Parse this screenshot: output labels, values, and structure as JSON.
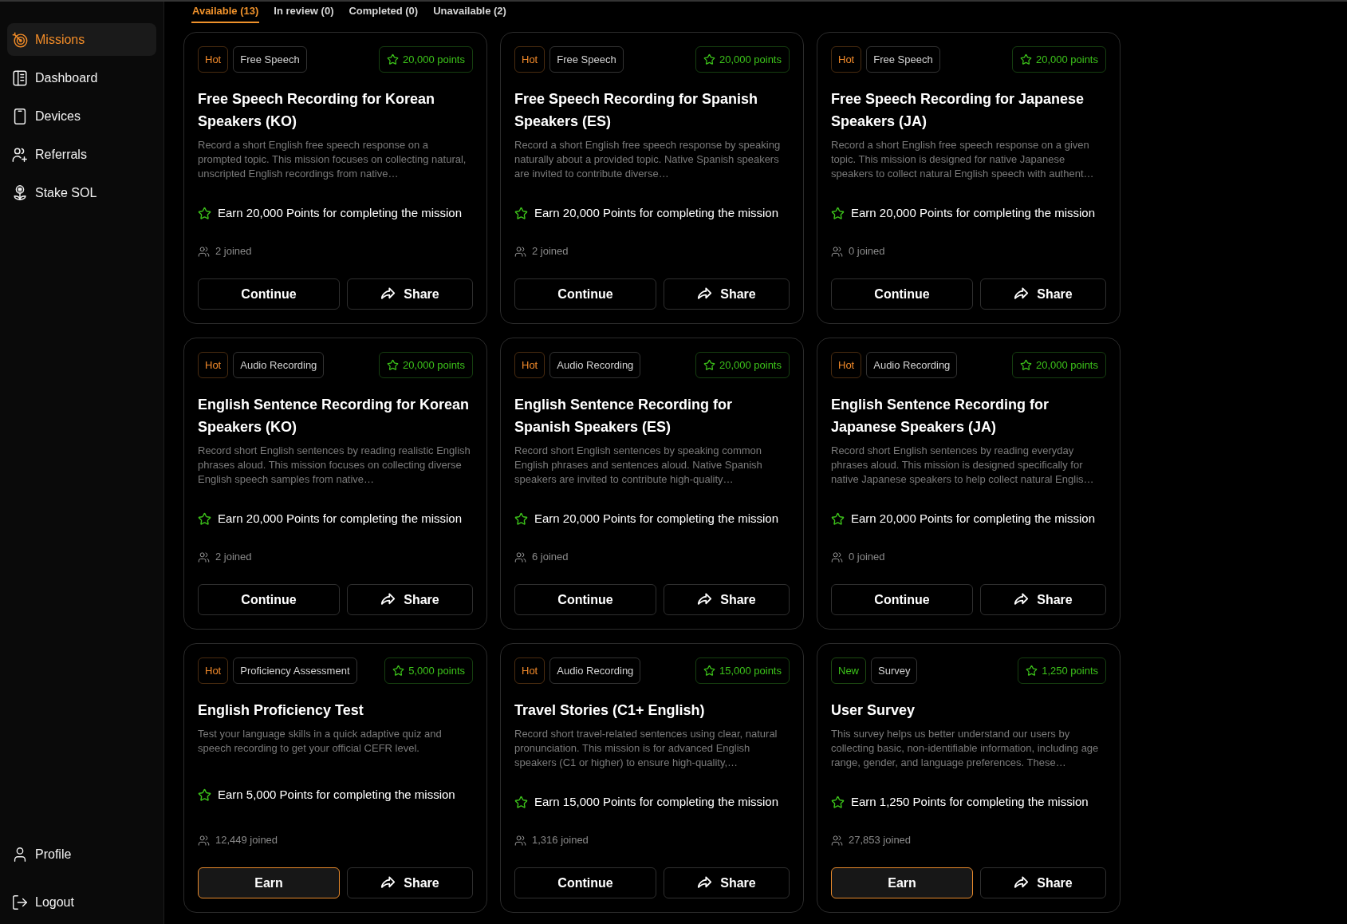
{
  "sidebar": {
    "items": [
      {
        "label": "Missions",
        "selected": true
      },
      {
        "label": "Dashboard",
        "selected": false
      },
      {
        "label": "Devices",
        "selected": false
      },
      {
        "label": "Referrals",
        "selected": false
      },
      {
        "label": "Stake SOL",
        "selected": false
      }
    ],
    "footer_items": [
      {
        "label": "Profile"
      },
      {
        "label": "Logout"
      }
    ]
  },
  "tabs": [
    {
      "label": "Available (13)",
      "selected": true
    },
    {
      "label": "In review (0)",
      "selected": false
    },
    {
      "label": "Completed (0)",
      "selected": false
    },
    {
      "label": "Unavailable (2)",
      "selected": false
    }
  ],
  "missions": [
    {
      "tags": [
        {
          "label": "Hot",
          "kind": "hot"
        },
        {
          "label": "Free Speech",
          "kind": "category"
        }
      ],
      "points": "20,000 points",
      "title": "Free Speech Recording for Korean Speakers (KO)",
      "description": "Record a short English free speech response on a prompted topic. This mission focuses on collecting natural, unscripted English recordings from native…",
      "reward": "Earn 20,000 Points for completing the mission",
      "joined": "2 joined",
      "action": {
        "label": "Continue",
        "highlighted": false
      },
      "share": "Share"
    },
    {
      "tags": [
        {
          "label": "Hot",
          "kind": "hot"
        },
        {
          "label": "Free Speech",
          "kind": "category"
        }
      ],
      "points": "20,000 points",
      "title": "Free Speech Recording for Spanish Speakers (ES)",
      "description": "Record a short English free speech response by speaking naturally about a provided topic. Native Spanish speakers are invited to contribute diverse…",
      "reward": "Earn 20,000 Points for completing the mission",
      "joined": "2 joined",
      "action": {
        "label": "Continue",
        "highlighted": false
      },
      "share": "Share"
    },
    {
      "tags": [
        {
          "label": "Hot",
          "kind": "hot"
        },
        {
          "label": "Free Speech",
          "kind": "category"
        }
      ],
      "points": "20,000 points",
      "title": "Free Speech Recording for Japanese Speakers (JA)",
      "description": "Record a short English free speech response on a given topic. This mission is designed for native Japanese speakers to collect natural English speech with authent…",
      "reward": "Earn 20,000 Points for completing the mission",
      "joined": "0 joined",
      "action": {
        "label": "Continue",
        "highlighted": false
      },
      "share": "Share"
    },
    {
      "tags": [
        {
          "label": "Hot",
          "kind": "hot"
        },
        {
          "label": "Audio Recording",
          "kind": "category"
        }
      ],
      "points": "20,000 points",
      "title": "English Sentence Recording for Korean Speakers (KO)",
      "description": "Record short English sentences by reading realistic English phrases aloud. This mission focuses on collecting diverse English speech samples from native…",
      "reward": "Earn 20,000 Points for completing the mission",
      "joined": "2 joined",
      "action": {
        "label": "Continue",
        "highlighted": false
      },
      "share": "Share"
    },
    {
      "tags": [
        {
          "label": "Hot",
          "kind": "hot"
        },
        {
          "label": "Audio Recording",
          "kind": "category"
        }
      ],
      "points": "20,000 points",
      "title": "English Sentence Recording for Spanish Speakers (ES)",
      "description": "Record short English sentences by speaking common English phrases and sentences aloud. Native Spanish speakers are invited to contribute high-quality…",
      "reward": "Earn 20,000 Points for completing the mission",
      "joined": "6 joined",
      "action": {
        "label": "Continue",
        "highlighted": false
      },
      "share": "Share"
    },
    {
      "tags": [
        {
          "label": "Hot",
          "kind": "hot"
        },
        {
          "label": "Audio Recording",
          "kind": "category"
        }
      ],
      "points": "20,000 points",
      "title": "English Sentence Recording for Japanese Speakers (JA)",
      "description": "Record short English sentences by reading everyday phrases aloud. This mission is designed specifically for native Japanese speakers to help collect natural Englis…",
      "reward": "Earn 20,000 Points for completing the mission",
      "joined": "0 joined",
      "action": {
        "label": "Continue",
        "highlighted": false
      },
      "share": "Share"
    },
    {
      "tags": [
        {
          "label": "Hot",
          "kind": "hot"
        },
        {
          "label": "Proficiency Assessment",
          "kind": "category"
        }
      ],
      "points": "5,000 points",
      "title": "English Proficiency Test",
      "description": "Test your language skills in a quick adaptive quiz and speech recording to get your official CEFR level.",
      "reward": "Earn 5,000 Points for completing the mission",
      "joined": "12,449 joined",
      "action": {
        "label": "Earn",
        "highlighted": true
      },
      "share": "Share"
    },
    {
      "tags": [
        {
          "label": "Hot",
          "kind": "hot"
        },
        {
          "label": "Audio Recording",
          "kind": "category"
        }
      ],
      "points": "15,000 points",
      "title": "Travel Stories (C1+ English)",
      "description": "Record short travel-related sentences using clear, natural pronunciation. This mission is for advanced English speakers (C1 or higher) to ensure high-quality,…",
      "reward": "Earn 15,000 Points for completing the mission",
      "joined": "1,316 joined",
      "action": {
        "label": "Continue",
        "highlighted": false
      },
      "share": "Share"
    },
    {
      "tags": [
        {
          "label": "New",
          "kind": "new"
        },
        {
          "label": "Survey",
          "kind": "category"
        }
      ],
      "points": "1,250 points",
      "title": "User Survey",
      "description": "This survey helps us better understand our users by collecting basic, non-identifiable information, including age range, gender, and language preferences. These…",
      "reward": "Earn 1,250 Points for completing the mission",
      "joined": "27,853 joined",
      "action": {
        "label": "Earn",
        "highlighted": true
      },
      "share": "Share"
    }
  ]
}
